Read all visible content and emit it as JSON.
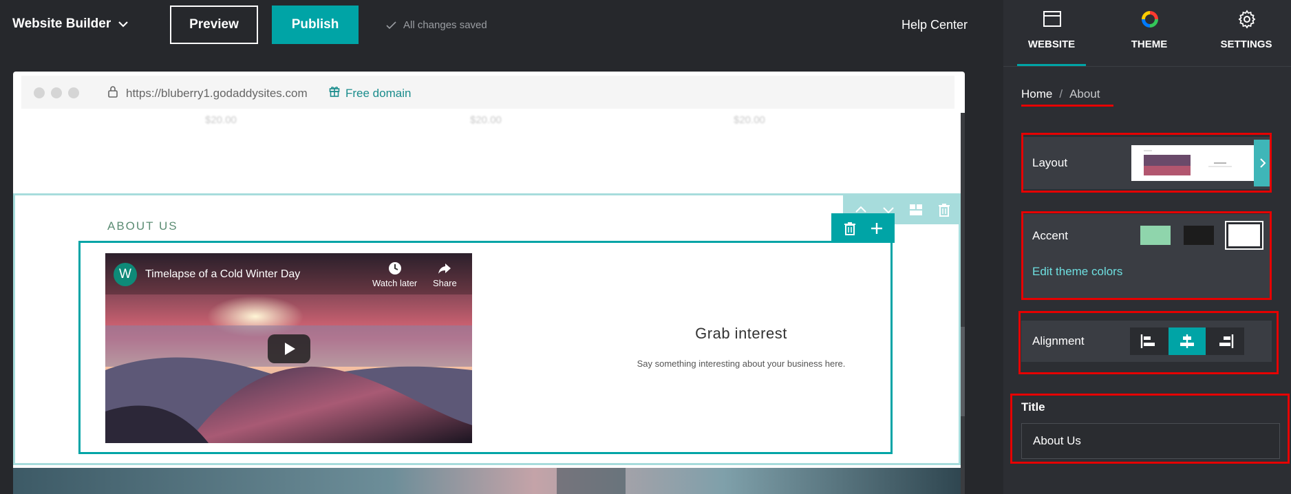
{
  "header": {
    "brand": "Website Builder",
    "preview_label": "Preview",
    "publish_label": "Publish",
    "saved_status": "All changes saved",
    "help_label": "Help Center"
  },
  "browser": {
    "url": "https://bluberry1.godaddysites.com",
    "free_domain_label": "Free domain"
  },
  "page": {
    "prices": [
      "$20.00",
      "$20.00",
      "$20.00"
    ],
    "section_heading": "ABOUT US",
    "video": {
      "channel_initial": "W",
      "title": "Timelapse of a Cold Winter Day",
      "watch_later_label": "Watch later",
      "share_label": "Share"
    },
    "headline": "Grab interest",
    "body_text": "Say something interesting about your business here."
  },
  "panel": {
    "tabs": [
      {
        "label": "WEBSITE",
        "icon": "browser-icon"
      },
      {
        "label": "THEME",
        "icon": "color-wheel-icon"
      },
      {
        "label": "SETTINGS",
        "icon": "gear-icon"
      }
    ],
    "active_tab": "WEBSITE",
    "breadcrumb": {
      "home": "Home",
      "separator": "/",
      "current": "About"
    },
    "layout_label": "Layout",
    "accent_label": "Accent",
    "accent_swatches": [
      "#8fd5ac",
      "#1c1c1c",
      "#ffffff"
    ],
    "edit_colors_label": "Edit theme colors",
    "alignment_label": "Alignment",
    "alignment_options": [
      "left",
      "center",
      "right"
    ],
    "alignment_selected": "center",
    "title_label": "Title",
    "title_value": "About Us"
  },
  "colors": {
    "accent_teal": "#00a4a6",
    "highlight_red": "#e60000",
    "panel_bg": "#2c2e33"
  }
}
